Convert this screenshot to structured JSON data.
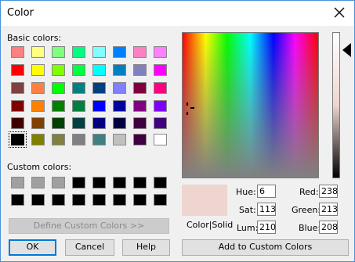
{
  "window": {
    "title": "Color"
  },
  "labels": {
    "basic": "Basic colors:",
    "custom": "Custom colors:",
    "colorsolid": "Color|Solid",
    "hue": "Hue:",
    "sat": "Sat:",
    "lum": "Lum:",
    "red": "Red:",
    "green": "Green:",
    "blue": "Blue:"
  },
  "values": {
    "hue": "6",
    "sat": "113",
    "lum": "210",
    "red": "238",
    "green": "213",
    "blue": "208"
  },
  "buttons": {
    "define": "Define Custom Colors >>",
    "ok": "OK",
    "cancel": "Cancel",
    "help": "Help",
    "add": "Add to Custom Colors"
  },
  "colors": {
    "current": "#eed5d0",
    "basic": [
      [
        "#ff8080",
        "#ffff80",
        "#80ff80",
        "#00ff80",
        "#80ffff",
        "#0080ff",
        "#ff80c0",
        "#ff80ff"
      ],
      [
        "#ff0000",
        "#ffff00",
        "#80ff00",
        "#00ff40",
        "#00ffff",
        "#0080c0",
        "#8080c0",
        "#ff00ff"
      ],
      [
        "#804040",
        "#ff8040",
        "#00ff00",
        "#008080",
        "#004080",
        "#8080ff",
        "#800040",
        "#ff0080"
      ],
      [
        "#800000",
        "#ff8000",
        "#008000",
        "#008040",
        "#0000ff",
        "#0000a0",
        "#800080",
        "#8000ff"
      ],
      [
        "#400000",
        "#804000",
        "#004000",
        "#004040",
        "#000080",
        "#000040",
        "#400040",
        "#400080"
      ],
      [
        "#000000",
        "#808000",
        "#808040",
        "#808080",
        "#408080",
        "#c0c0c0",
        "#400040",
        "#ffffff"
      ]
    ],
    "custom": [
      [
        "#a0a0a0",
        "#a0a0a0",
        "#a0a0a0",
        "#000000",
        "#000000",
        "#000000",
        "#000000",
        "#000000"
      ],
      [
        "#000000",
        "#000000",
        "#000000",
        "#000000",
        "#000000",
        "#000000",
        "#000000",
        "#000000"
      ]
    ]
  }
}
